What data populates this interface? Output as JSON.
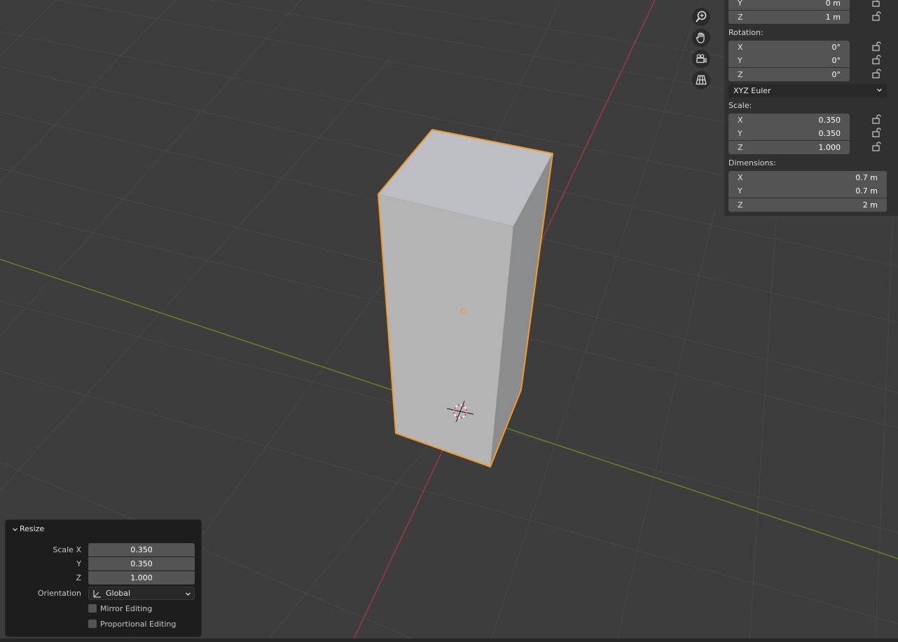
{
  "viewport": {
    "nav_buttons": [
      "zoom-icon",
      "pan-hand-icon",
      "camera-view-icon",
      "ortho-grid-icon"
    ]
  },
  "properties": {
    "location": {
      "y": {
        "axis": "Y",
        "value": "0 m"
      },
      "z": {
        "axis": "Z",
        "value": "1 m"
      }
    },
    "rotation": {
      "label": "Rotation:",
      "x": {
        "axis": "X",
        "value": "0°"
      },
      "y": {
        "axis": "Y",
        "value": "0°"
      },
      "z": {
        "axis": "Z",
        "value": "0°"
      },
      "mode": "XYZ Euler"
    },
    "scale": {
      "label": "Scale:",
      "x": {
        "axis": "X",
        "value": "0.350"
      },
      "y": {
        "axis": "Y",
        "value": "0.350"
      },
      "z": {
        "axis": "Z",
        "value": "1.000"
      }
    },
    "dimensions": {
      "label": "Dimensions:",
      "x": {
        "axis": "X",
        "value": "0.7 m"
      },
      "y": {
        "axis": "Y",
        "value": "0.7 m"
      },
      "z": {
        "axis": "Z",
        "value": "2 m"
      }
    }
  },
  "resize_panel": {
    "title": "Resize",
    "scale_x_label": "Scale X",
    "scale_y_label": "Y",
    "scale_z_label": "Z",
    "scale_x": "0.350",
    "scale_y": "0.350",
    "scale_z": "1.000",
    "orientation_label": "Orientation",
    "orientation_value": "Global",
    "mirror_editing": {
      "label": "Mirror Editing",
      "checked": false
    },
    "proportional_editing": {
      "label": "Proportional Editing",
      "checked": false
    }
  },
  "colors": {
    "viewport_bg": "#3d3d3d",
    "grid": "#4a4a4a",
    "x_axis": "#a83a45",
    "y_axis": "#6b8c22",
    "selection_outline": "#f09a2c"
  }
}
